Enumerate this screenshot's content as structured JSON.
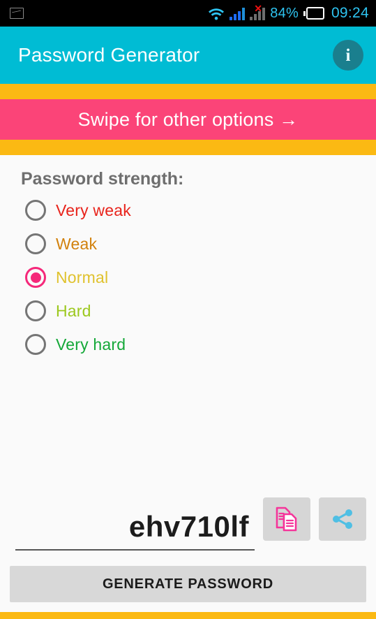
{
  "status_bar": {
    "notification_icon": "image-screenshot-icon",
    "wifi_icon": "wifi-icon",
    "signal_sim1_icon": "signal-bars-icon",
    "signal_sim2_icon": "signal-bars-no-service-icon",
    "battery_percent": "84%",
    "battery_icon": "battery-icon",
    "time": "09:24",
    "colors": {
      "accent": "#2ec3f0",
      "background": "#000000",
      "error": "#ee1111"
    }
  },
  "app_bar": {
    "title": "Password Generator",
    "info_icon": "info-icon",
    "info_glyph": "i",
    "background": "#00bcd4"
  },
  "swipe_banner": {
    "text": "Swipe for other options  →",
    "background": "#fb4478",
    "accent_band": "#fbb913"
  },
  "strength": {
    "label": "Password strength:",
    "selected": "Normal",
    "options": [
      {
        "label": "Very weak",
        "color": "#e8231b",
        "selected": false
      },
      {
        "label": "Weak",
        "color": "#d2810c",
        "selected": false
      },
      {
        "label": "Normal",
        "color": "#e0c22e",
        "selected": true
      },
      {
        "label": "Hard",
        "color": "#9cc81e",
        "selected": false
      },
      {
        "label": "Very hard",
        "color": "#14a838",
        "selected": false
      }
    ],
    "radio_selected_color": "#f5287a",
    "radio_unselected_color": "#757575"
  },
  "password_output": {
    "value": "ehv710lf",
    "copy_icon": "copy-icon",
    "copy_icon_color": "#f5349a",
    "share_icon": "share-icon",
    "share_icon_color": "#4fbfe4"
  },
  "generate": {
    "label": "GENERATE PASSWORD"
  }
}
